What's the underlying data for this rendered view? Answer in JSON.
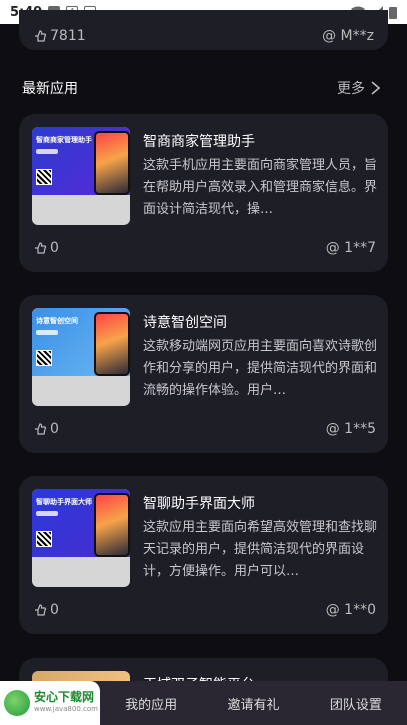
{
  "status_bar": {
    "time": "5:49"
  },
  "top_card": {
    "likes": "7811",
    "author": "@ M**z"
  },
  "section": {
    "title": "最新应用",
    "more": "更多"
  },
  "cards": [
    {
      "title": "智商商家管理助手",
      "desc": "这款手机应用主要面向商家管理人员，旨在帮助用户高效录入和管理商家信息。界面设计简洁现代，操…",
      "likes": "0",
      "author": "@ 1**7",
      "thumb_title": "智商商家管理助手"
    },
    {
      "title": "诗意智创空间",
      "desc": "这款移动端网页应用主要面向喜欢诗歌创作和分享的用户，提供简洁现代的界面和流畅的操作体验。用户…",
      "likes": "0",
      "author": "@ 1**5",
      "thumb_title": "诗意智创空间"
    },
    {
      "title": "智聊助手界面大师",
      "desc": "这款应用主要面向希望高效管理和查找聊天记录的用户，提供简洁现代的界面设计，方便操作。用户可以…",
      "likes": "0",
      "author": "@ 1**0",
      "thumb_title": "智聊助手界面大师"
    }
  ],
  "partial_card": {
    "title": "天域双子智能平台"
  },
  "tabbar": {
    "logo_main": "安心下载网",
    "logo_sub": "www.java800.com",
    "tab2": "我的应用",
    "tab3": "邀请有礼",
    "tab4": "团队设置"
  }
}
